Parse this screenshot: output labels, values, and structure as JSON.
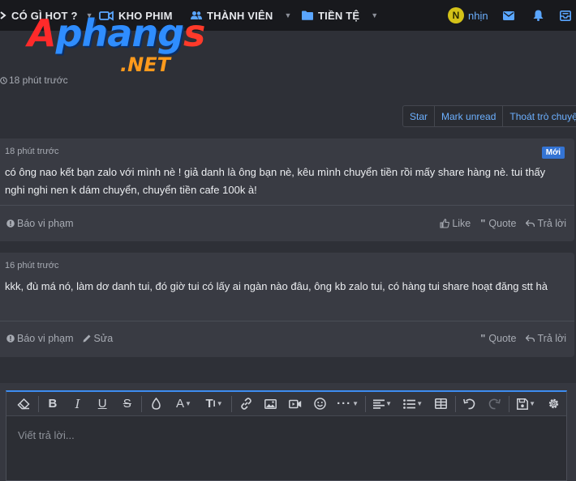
{
  "nav": {
    "items": [
      {
        "label": "CÓ GÌ HOT ?",
        "icon": "chevron-right-icon"
      },
      {
        "label": "KHO PHIM",
        "icon": "video-icon"
      },
      {
        "label": "THÀNH VIÊN",
        "icon": "users-icon"
      },
      {
        "label": "TIỀN TỆ",
        "icon": "folder-icon"
      }
    ],
    "user": {
      "initial": "N",
      "name": "nhịn"
    },
    "icons": [
      "mail-icon",
      "bell-icon",
      "inbox-icon"
    ]
  },
  "logo": {
    "main_first": "A",
    "main_rest": "phang",
    "main_last": "s",
    "sub": ".NET"
  },
  "thread": {
    "time": "18 phút trước"
  },
  "actions": {
    "star": "Star",
    "mark_unread": "Mark unread",
    "leave": "Thoát trò chuyện"
  },
  "posts": [
    {
      "time": "18 phút trước",
      "badge": "Mới",
      "content": "có ông nao kết bạn zalo với mình nè ! giả danh là ông bạn nè, kêu mình chuyển tiền rồi mấy share hàng nè. tui thấy nghi nghi nen k dám chuyển, chuyển tiền cafe 100k à!",
      "report": "Báo vi phạm",
      "like": "Like",
      "quote": "Quote",
      "reply": "Trả lời"
    },
    {
      "time": "16 phút trước",
      "content": "kkk, đù má nó, làm dơ danh tui, đó giờ tui có lấy ai ngàn nào đâu, ông kb zalo tui, có hàng tui share hoạt đăng stt hà",
      "report": "Báo vi phạm",
      "edit": "Sửa",
      "quote": "Quote",
      "reply": "Trả lời"
    }
  ],
  "editor": {
    "placeholder": "Viết trả lời..."
  },
  "colors": {
    "accent": "#3d8cf0",
    "link": "#6cb0ff",
    "badge": "#3474d4",
    "nav_bg": "#18191d",
    "body_bg": "#2e3037"
  }
}
